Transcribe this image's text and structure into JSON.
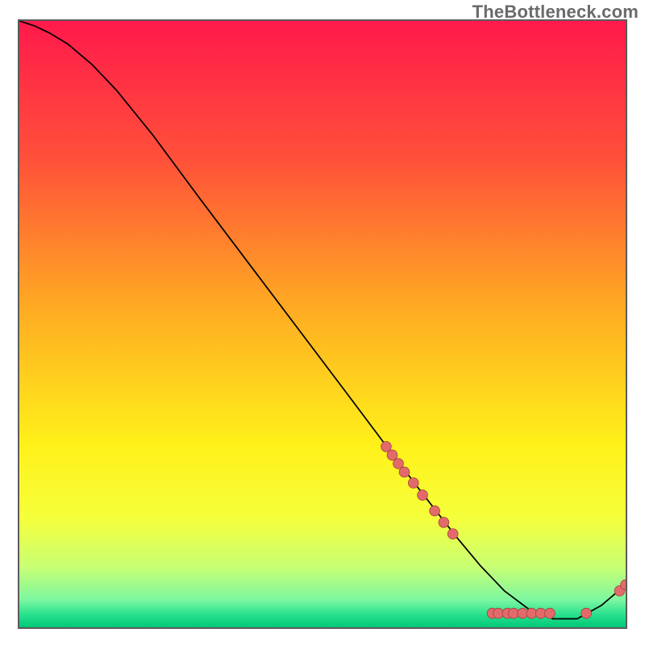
{
  "watermark": "TheBottleneck.com",
  "colors": {
    "curve": "#000000",
    "marker_fill": "#e36a6a",
    "marker_stroke": "#a13d3d",
    "border": "#5b5b5b"
  },
  "chart_data": {
    "type": "line",
    "title": "",
    "xlabel": "",
    "ylabel": "",
    "xlim": [
      0,
      100
    ],
    "ylim": [
      0,
      100
    ],
    "grid": false,
    "axes_visible": false,
    "background_gradient": [
      {
        "offset": 0.0,
        "color": "#ff1a4b"
      },
      {
        "offset": 0.23,
        "color": "#ff5139"
      },
      {
        "offset": 0.48,
        "color": "#ffad22"
      },
      {
        "offset": 0.7,
        "color": "#fff11a"
      },
      {
        "offset": 0.82,
        "color": "#f5ff3b"
      },
      {
        "offset": 0.9,
        "color": "#c9ff74"
      },
      {
        "offset": 0.955,
        "color": "#7cf7a0"
      },
      {
        "offset": 0.98,
        "color": "#25e08d"
      },
      {
        "offset": 1.0,
        "color": "#00c878"
      }
    ],
    "series": [
      {
        "name": "bottleneck-curve",
        "x": [
          0.0,
          2.5,
          5.0,
          8.0,
          12.0,
          16.0,
          22.0,
          30.0,
          38.0,
          46.0,
          54.0,
          60.0,
          66.0,
          72.0,
          76.0,
          80.0,
          84.0,
          88.0,
          92.0,
          96.0,
          100.0
        ],
        "y": [
          100.0,
          99.2,
          98.0,
          96.2,
          92.8,
          88.6,
          81.2,
          70.4,
          59.8,
          49.2,
          38.6,
          30.6,
          22.7,
          15.0,
          10.2,
          6.0,
          3.0,
          1.4,
          1.4,
          3.6,
          7.0
        ]
      }
    ],
    "markers": [
      {
        "x": 60.5,
        "y": 29.8
      },
      {
        "x": 61.5,
        "y": 28.4
      },
      {
        "x": 62.5,
        "y": 27.0
      },
      {
        "x": 63.5,
        "y": 25.6
      },
      {
        "x": 65.0,
        "y": 23.8
      },
      {
        "x": 66.5,
        "y": 21.8
      },
      {
        "x": 68.5,
        "y": 19.2
      },
      {
        "x": 70.0,
        "y": 17.3
      },
      {
        "x": 71.5,
        "y": 15.4
      },
      {
        "x": 78.0,
        "y": 2.3
      },
      {
        "x": 79.0,
        "y": 2.3
      },
      {
        "x": 80.5,
        "y": 2.3
      },
      {
        "x": 81.5,
        "y": 2.3
      },
      {
        "x": 83.0,
        "y": 2.3
      },
      {
        "x": 84.5,
        "y": 2.3
      },
      {
        "x": 86.0,
        "y": 2.3
      },
      {
        "x": 87.5,
        "y": 2.3
      },
      {
        "x": 93.5,
        "y": 2.3
      },
      {
        "x": 99.0,
        "y": 6.0
      },
      {
        "x": 100.0,
        "y": 7.0
      }
    ]
  }
}
